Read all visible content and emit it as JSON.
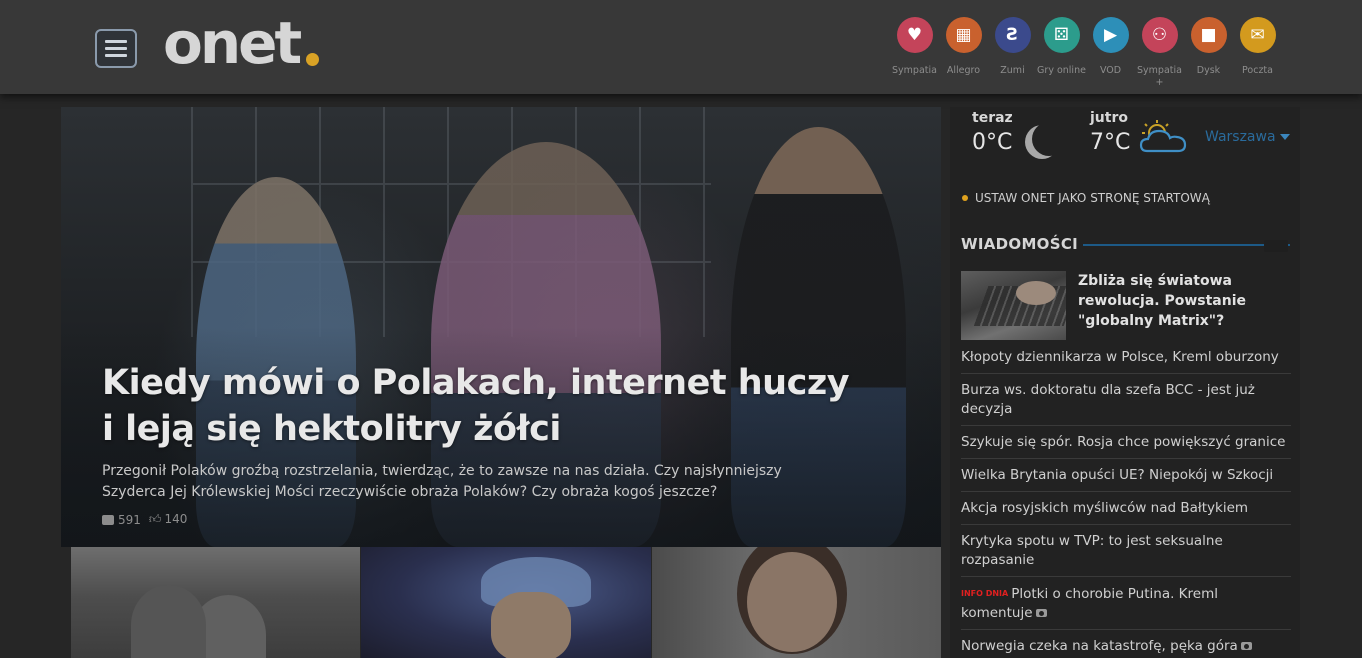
{
  "header": {
    "logo_text": "onet",
    "services": [
      {
        "label": "Sympatia",
        "icon": "heart-icon",
        "color": "#c4445a",
        "glyph": "♥"
      },
      {
        "label": "Allegro",
        "icon": "basket-icon",
        "color": "#c9612e",
        "glyph": "▦"
      },
      {
        "label": "Zumi",
        "icon": "zumi-icon",
        "color": "#3b4a8c",
        "glyph": "Ƨ"
      },
      {
        "label": "Gry online",
        "icon": "dice-icon",
        "color": "#2c9c8c",
        "glyph": "⚄"
      },
      {
        "label": "VOD",
        "icon": "play-icon",
        "color": "#2d8fb8",
        "glyph": "▶"
      },
      {
        "label": "Sympatia +",
        "icon": "couple-icon",
        "color": "#c4445a",
        "glyph": "⚇"
      },
      {
        "label": "Dysk",
        "icon": "disk-icon",
        "color": "#c9612e",
        "glyph": "■"
      },
      {
        "label": "Poczta",
        "icon": "mail-icon",
        "color": "#d39a1e",
        "glyph": "✉"
      }
    ]
  },
  "hero": {
    "title": "Kiedy mówi o Polakach, internet huczy i leją się hektolitry żółci",
    "lead": "Przegonił Polaków groźbą rozstrzelania, twierdząc, że to zawsze na nas działa. Czy najsłynniejszy Szyderca Jej Królewskiej Mości rzeczywiście obraża Polaków? Czy obraża kogoś jeszcze?",
    "comments": "591",
    "likes": "140"
  },
  "weather": {
    "now_label": "teraz",
    "now_temp": "0°C",
    "tomorrow_label": "jutro",
    "tomorrow_temp": "7°C",
    "city": "Warszawa"
  },
  "startpage_link": "USTAW ONET JAKO STRONĘ STARTOWĄ",
  "news": {
    "section_title": "WIADOMOŚCI",
    "lead_title": "Zbliża się światowa rewolucja. Powstanie \"globalny Matrix\"?",
    "items": [
      {
        "tag": "",
        "text": "Kłopoty dziennikarza w Polsce, Kreml oburzony",
        "camera": false
      },
      {
        "tag": "",
        "text": "Burza ws. doktoratu dla szefa BCC - jest już decyzja",
        "camera": false
      },
      {
        "tag": "",
        "text": "Szykuje się spór. Rosja chce powiększyć granice",
        "camera": false
      },
      {
        "tag": "",
        "text": "Wielka Brytania opuści UE? Niepokój w Szkocji",
        "camera": false
      },
      {
        "tag": "",
        "text": "Akcja rosyjskich myśliwców nad Bałtykiem",
        "camera": false
      },
      {
        "tag": "",
        "text": "Krytyka spotu w TVP: to jest seksualne rozpasanie",
        "camera": false
      },
      {
        "tag": "INFO DNIA",
        "text": "Plotki o chorobie Putina. Kreml komentuje",
        "camera": true
      },
      {
        "tag": "",
        "text": "Norwegia czeka na katastrofę, pęka góra",
        "camera": true
      }
    ]
  }
}
